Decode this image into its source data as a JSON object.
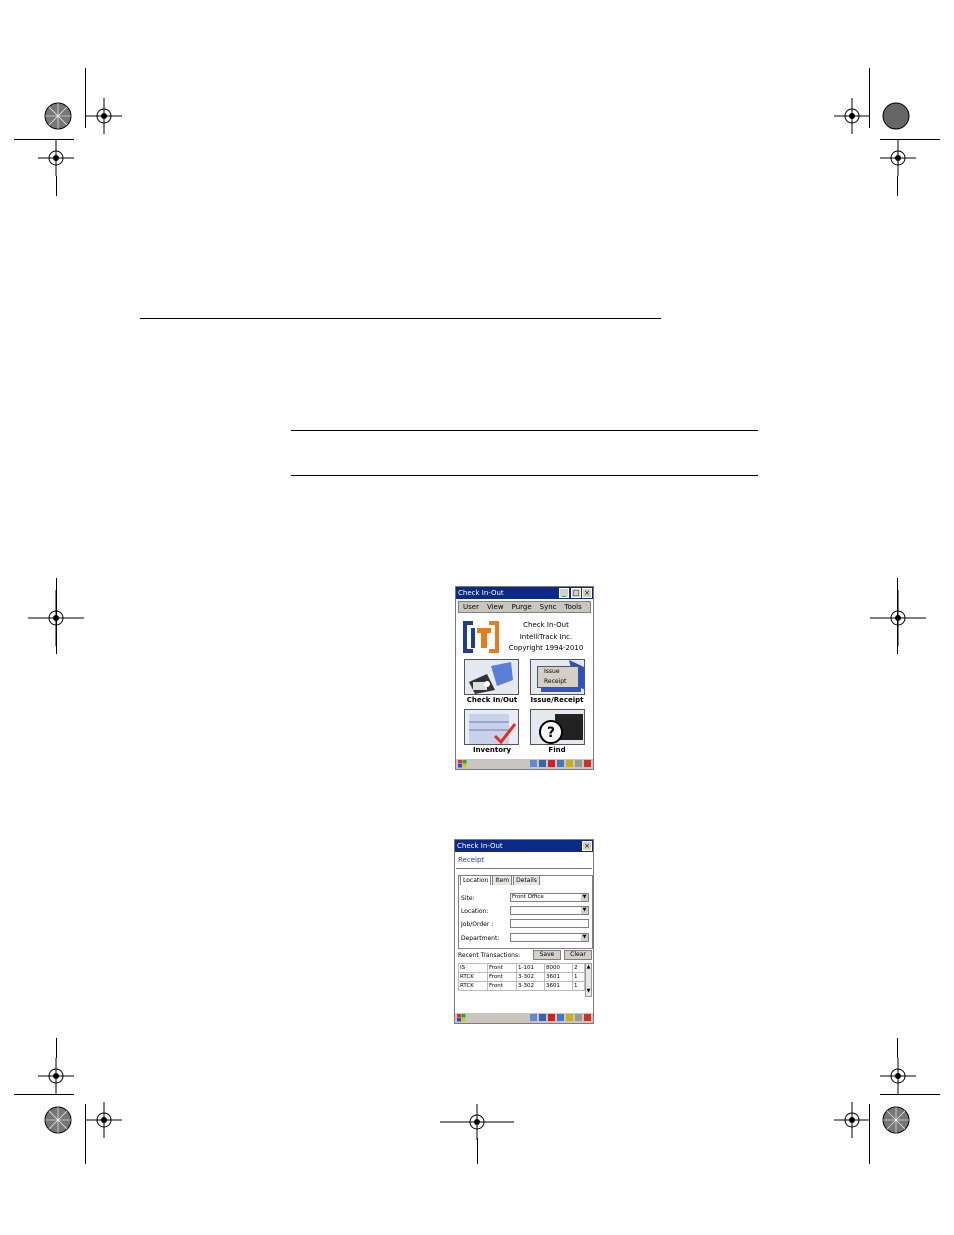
{
  "screen1": {
    "title": "Check In-Out",
    "menu": [
      "User",
      "View",
      "Purge",
      "Sync",
      "Tools"
    ],
    "about": {
      "logo": "IT",
      "line1": "Check In-Out",
      "line2": "IntelliTrack Inc.",
      "line3": "Copyright 1994-2010"
    },
    "tiles": [
      {
        "label": "Check In/Out",
        "icon": "barcode-scanner-icon"
      },
      {
        "label": "Issue/Receipt",
        "icon": "issue-receipt-icon",
        "menu": [
          "Issue",
          "Receipt"
        ]
      },
      {
        "label": "Inventory",
        "icon": "inventory-icon"
      },
      {
        "label": "Find",
        "icon": "find-question-icon"
      }
    ]
  },
  "screen2": {
    "title": "Check In-Out",
    "subtitle": "Receipt",
    "tabs": [
      "Location",
      "Item",
      "Details"
    ],
    "fields": {
      "site_label": "Site:",
      "site_value": "Front Office",
      "location_label": "Location:",
      "job_label": "Job/Order :",
      "department_label": "Department:"
    },
    "recent_label": "Recent Transactions:",
    "save_label": "Save",
    "clear_label": "Clear",
    "rows": [
      [
        "IS",
        "Front",
        "1-101",
        "8000",
        "2"
      ],
      [
        "RTCK",
        "Front",
        "3-302",
        "3601",
        "1"
      ],
      [
        "RTCK",
        "Front",
        "3-302",
        "3601",
        "1"
      ]
    ]
  },
  "colors": {
    "titlebar": "#0a2a86",
    "chrome": "#c9c6bf",
    "logo_blue": "#1e3f8f",
    "logo_orange": "#e87b1e",
    "subtitle_blue": "#1a3ad0"
  }
}
